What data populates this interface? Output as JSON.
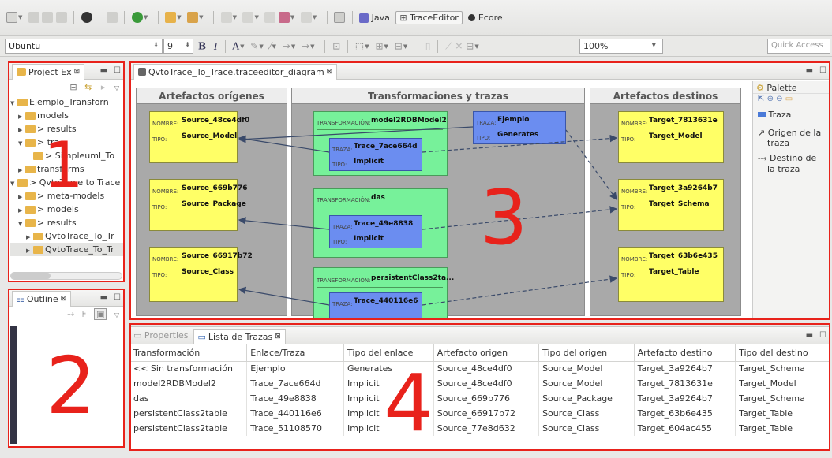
{
  "toolbar": {
    "perspective_java": "Java",
    "perspective_traceeditor": "TraceEditor",
    "perspective_ecore": "Ecore",
    "font_name": "Ubuntu",
    "font_size": "9",
    "bold": "B",
    "italic": "I",
    "zoom": "100%",
    "quick_access": "Quick Access"
  },
  "project_explorer": {
    "title": "Project Ex",
    "items": [
      {
        "label": "Ejemplo_Transforn",
        "indent": 0,
        "expanded": true
      },
      {
        "label": "models",
        "indent": 1,
        "expanded": false
      },
      {
        "label": "> results",
        "indent": 1,
        "expanded": false
      },
      {
        "label": "> tra",
        "indent": 1,
        "expanded": true
      },
      {
        "label": "> Simpleuml_To",
        "indent": 2,
        "expanded": null
      },
      {
        "label": "transforms",
        "indent": 1,
        "expanded": false
      },
      {
        "label": "> QvtoTrace to Trace",
        "indent": 0,
        "expanded": true
      },
      {
        "label": "> meta-models",
        "indent": 1,
        "expanded": false
      },
      {
        "label": "> models",
        "indent": 1,
        "expanded": false
      },
      {
        "label": "> results",
        "indent": 1,
        "expanded": true
      },
      {
        "label": "QvtoTrace_To_Tr",
        "indent": 2,
        "expanded": false
      },
      {
        "label": "QvtoTrace_To_Tr",
        "indent": 2,
        "expanded": false
      }
    ]
  },
  "outline": {
    "title": "Outline"
  },
  "editor": {
    "tab": "QvtoTrace_To_Trace.traceeditor_diagram",
    "lanes": {
      "origins": "Artefactos orígenes",
      "transforms": "Transformaciones y trazas",
      "targets": "Artefactos destinos"
    },
    "labels": {
      "nombre": "NOMBRE:",
      "tipo": "TIPO:",
      "transformacion": "TRANSFORMACIÓN:",
      "traza": "TRAZA:"
    },
    "sources": [
      {
        "name": "Source_48ce4df0",
        "type": "Source_Model"
      },
      {
        "name": "Source_669b776",
        "type": "Source_Package"
      },
      {
        "name": "Source_66917b72",
        "type": "Source_Class"
      }
    ],
    "transformations": [
      {
        "name": "model2RDBModel2",
        "trace": "Trace_7ace664d",
        "kind": "Implicit"
      },
      {
        "name": "das",
        "trace": "Trace_49e8838",
        "kind": "Implicit"
      },
      {
        "name": "persistentClass2ta...",
        "trace": "Trace_440116e6",
        "kind": "Implicit"
      }
    ],
    "free_trace": {
      "name": "Ejemplo",
      "kind": "Generates"
    },
    "targets": [
      {
        "name": "Target_7813631e",
        "type": "Target_Model"
      },
      {
        "name": "Target_3a9264b7",
        "type": "Target_Schema"
      },
      {
        "name": "Target_63b6e435",
        "type": "Target_Table"
      }
    ]
  },
  "palette": {
    "title": "Palette",
    "items": [
      "Traza",
      "Origen de la traza",
      "Destino de la traza"
    ]
  },
  "bottom": {
    "tab_properties": "Properties",
    "tab_traces": "Lista de Trazas",
    "columns": [
      "Transformación",
      "Enlace/Traza",
      "Tipo del enlace",
      "Artefacto origen",
      "Tipo del origen",
      "Artefacto destino",
      "Tipo del destino"
    ],
    "rows": [
      [
        "<< Sin transformación",
        "Ejemplo",
        "Generates",
        "Source_48ce4df0",
        "Source_Model",
        "Target_3a9264b7",
        "Target_Schema"
      ],
      [
        "model2RDBModel2",
        "Trace_7ace664d",
        "Implicit",
        "Source_48ce4df0",
        "Source_Model",
        "Target_7813631e",
        "Target_Model"
      ],
      [
        "das",
        "Trace_49e8838",
        "Implicit",
        "Source_669b776",
        "Source_Package",
        "Target_3a9264b7",
        "Target_Schema"
      ],
      [
        "persistentClass2table",
        "Trace_440116e6",
        "Implicit",
        "Source_66917b72",
        "Source_Class",
        "Target_63b6e435",
        "Target_Table"
      ],
      [
        "persistentClass2table",
        "Trace_51108570",
        "Implicit",
        "Source_77e8d632",
        "Source_Class",
        "Target_604ac455",
        "Target_Table"
      ]
    ]
  },
  "annotations": [
    "1",
    "2",
    "3",
    "4"
  ],
  "colors": {
    "annotation": "#e8221b",
    "source_node": "#ffff66",
    "transform_node": "#77f19a",
    "trace_node": "#6b8df0"
  }
}
